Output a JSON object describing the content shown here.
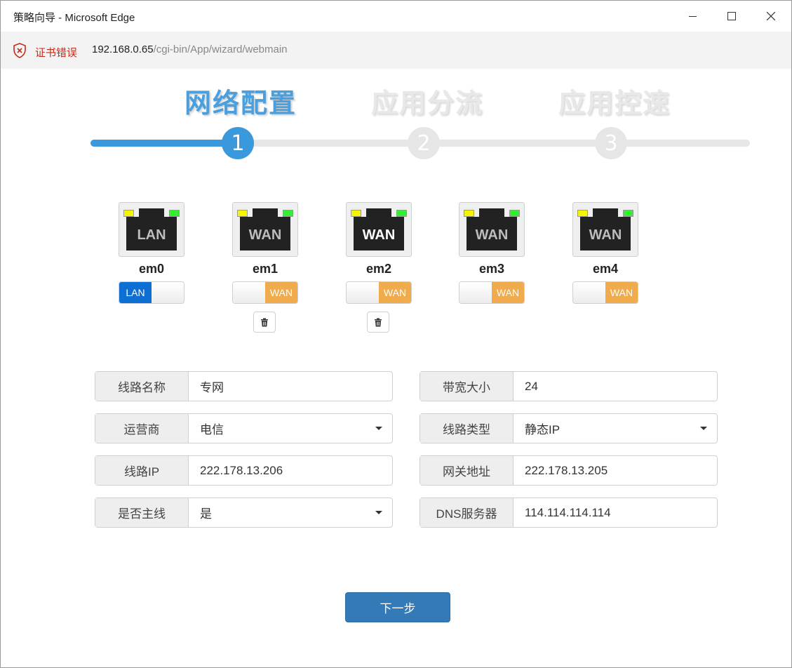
{
  "window": {
    "title": "策略向导 - Microsoft Edge",
    "minimize": "—",
    "maximize": "☐",
    "close": "✕"
  },
  "address": {
    "cert_label": "证书错误",
    "url_host": "192.168.0.65",
    "url_path": "/cgi-bin/App/wizard/webmain"
  },
  "steps": [
    {
      "title": "网络配置",
      "number": "1",
      "state": "active"
    },
    {
      "title": "应用分流",
      "number": "2",
      "state": "inactive"
    },
    {
      "title": "应用控速",
      "number": "3",
      "state": "inactive"
    }
  ],
  "progress": {
    "current_step": 1,
    "total_steps": 3
  },
  "ports": [
    {
      "name": "em0",
      "jack_label": "LAN",
      "mode": "LAN",
      "deletable": false
    },
    {
      "name": "em1",
      "jack_label": "WAN",
      "mode": "WAN",
      "deletable": true
    },
    {
      "name": "em2",
      "jack_label": "WAN",
      "mode": "WAN",
      "deletable": true
    },
    {
      "name": "em3",
      "jack_label": "WAN",
      "mode": "WAN",
      "deletable": false
    },
    {
      "name": "em4",
      "jack_label": "WAN",
      "mode": "WAN",
      "deletable": false
    }
  ],
  "toggle": {
    "lan": "LAN",
    "wan": "WAN"
  },
  "form": {
    "line_name": {
      "label": "线路名称",
      "value": "专网"
    },
    "bandwidth": {
      "label": "带宽大小",
      "value": "24"
    },
    "isp": {
      "label": "运营商",
      "value": "电信"
    },
    "line_type": {
      "label": "线路类型",
      "value": "静态IP"
    },
    "line_ip": {
      "label": "线路IP",
      "value": "222.178.13.206"
    },
    "gateway": {
      "label": "网关地址",
      "value": "222.178.13.205"
    },
    "is_main": {
      "label": "是否主线",
      "value": "是"
    },
    "dns": {
      "label": "DNS服务器",
      "value": "114.114.114.114"
    }
  },
  "next_button": "下一步",
  "colors": {
    "accent": "#3a98dc",
    "lan": "#0d6fd4",
    "wan": "#f0ab4c",
    "button": "#337ab7",
    "cert_error": "#c42b1c"
  }
}
